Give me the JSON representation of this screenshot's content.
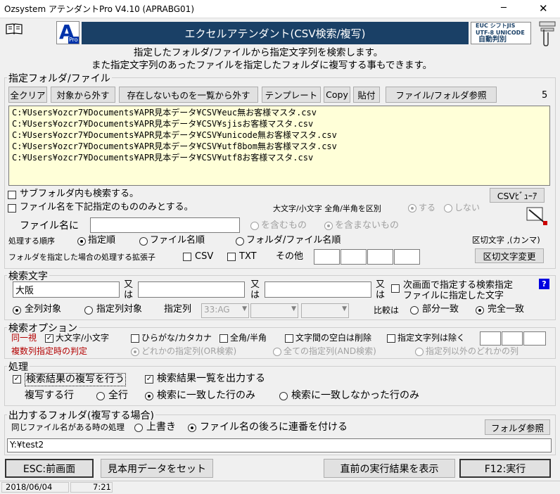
{
  "window": {
    "title": "Ozsystem アテンダントPro V4.10 (APRABG01)",
    "minimize": "─",
    "close": "✕"
  },
  "header": {
    "logo_letter": "A",
    "logo_sub": "Pro",
    "banner": "エクセルアテンダント(CSV検索/複写)",
    "encoding_line1": "EUC   シフトJIS",
    "encoding_line2": "UTF-8  UNICODE",
    "encoding_line3": "自動判別",
    "desc_line1": "指定したフォルダ/ファイルから指定文字列を検索します。",
    "desc_line2": "また指定文字列のあったファイルを指定したフォルダに複写する事もできます。"
  },
  "folder_group": {
    "label": "指定フォルダ/ファイル",
    "buttons": [
      "全クリア",
      "対象から外す",
      "存在しないものを一覧から外す",
      "テンプレート",
      "Copy",
      "貼付",
      "ファイル/フォルダ参照"
    ],
    "count": "5",
    "files": [
      "C:¥Users¥ozcr7¥Documents¥APR見本データ¥CSV¥euc無お客様マスタ.csv",
      "C:¥Users¥ozcr7¥Documents¥APR見本データ¥CSV¥sjisお客様マスタ.csv",
      "C:¥Users¥ozcr7¥Documents¥APR見本データ¥CSV¥unicode無お客様マスタ.csv",
      "C:¥Users¥ozcr7¥Documents¥APR見本データ¥CSV¥utf8bom無お客様マスタ.csv",
      "C:¥Users¥ozcr7¥Documents¥APR見本データ¥CSV¥utf8お客様マスタ.csv"
    ],
    "subfolder_check": "サブフォルダ内も検索する。",
    "csv_viewer_button": "CSVﾋﾞｭｰｱ",
    "filename_only_check": "ファイル名を下記指定のもののみとする。",
    "case_label": "大文字/小文字 全角/半角を区別",
    "case_yes": "する",
    "case_no": "しない",
    "filename_label": "ファイル名に",
    "filename_value": "",
    "contains": "を含むもの",
    "not_contains": "を含まないもの",
    "order_label": "処理する順序",
    "order_options": [
      "指定順",
      "ファイル名順",
      "フォルダ/ファイル名順"
    ],
    "delimiter_label": "区切文字 ,(カンマ)",
    "extension_label": "フォルダを指定した場合の処理する拡張子",
    "ext_csv": "CSV",
    "ext_txt": "TXT",
    "ext_other": "その他",
    "delimiter_button": "区切文字変更"
  },
  "search_group": {
    "label": "検索文字",
    "field1": "大阪",
    "field2": "",
    "field3": "",
    "or_label_1": "又",
    "or_label_2": "は",
    "next_screen_check_line1": "次画面で指定する検索指定",
    "next_screen_check_line2": "ファイルに指定した文字",
    "help": "?",
    "all_columns": "全列対象",
    "specified_columns": "指定列対象",
    "columns_label": "指定列",
    "columns_value": "33:AG",
    "compare_label": "比較は",
    "partial": "部分一致",
    "exact": "完全一致"
  },
  "options_group": {
    "label": "検索オプション",
    "same_label": "同一視",
    "case": "大文字/小文字",
    "kana": "ひらがな/カタカナ",
    "width": "全角/半角",
    "spaces": "文字間の空白は削除",
    "exclude": "指定文字列は除く",
    "multi_label": "複数列指定時の判定",
    "multi_any": "どれかの指定列(OR検索)",
    "multi_all": "全ての指定列(AND検索)",
    "multi_other": "指定列以外のどれかの列"
  },
  "process_group": {
    "label": "処理",
    "copy_results": "検索結果の複写を行う",
    "output_list": "検索結果一覧を出力する",
    "copy_rows_label": "複写する行",
    "all_rows": "全行",
    "matched_rows": "検索に一致した行のみ",
    "unmatched_rows": "検索に一致しなかった行のみ"
  },
  "output_group": {
    "label": "出力するフォルダ(複写する場合)",
    "same_name_label": "同じファイル名がある時の処理",
    "overwrite": "上書き",
    "append_number": "ファイル名の後ろに連番を付ける",
    "browse_button": "フォルダ参照",
    "path": "Y:¥test2"
  },
  "footer": {
    "esc_button": "ESC:前画面",
    "sample_button": "見本用データをセット",
    "prev_result_button": "直前の実行結果を表示",
    "run_button": "F12:実行",
    "date": "2018/06/04",
    "time": "7:21"
  }
}
